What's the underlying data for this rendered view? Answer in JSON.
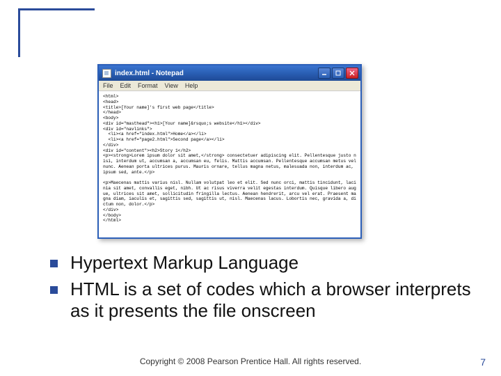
{
  "notepad": {
    "title": "index.html - Notepad",
    "menus": [
      "File",
      "Edit",
      "Format",
      "View",
      "Help"
    ],
    "content": "<html>\n<head>\n<title>[Your name]'s first web page</title>\n</head>\n<body>\n<div id=\"masthead\"><h1>[Your name]&rsquo;s website</h1></div>\n<div id=\"navlinks\">\n  <li><a href=\"index.html\">Home</a></li>\n  <li><a href=\"page2.html\">Second page</a></li>\n</div>\n<div id=\"content\"><h2>Story 1</h2>\n<p><strong>Lorem ipsum dolor sit amet,</strong> consectetuer adipiscing elit. Pellentesque justo nisi, interdum ut, accumsan a, accumsan eu, felis. Mattis accumsan. Pellentesque accumsan metus vel nunc. Aenean porta ultrices purus. Mauris ornare, tellus magna netus, malesuada non, interdum ac, ipsum sed, ante.</p>\n\n<p>Maecenas mattis varius nisl. Nullam volutpat leo et elit. Sed nunc orci, mattis tincidunt, lacinia sit amet, convallis eget, nibh. Ut ac risus viverra velit egestas interdum. Quisque libero augue, ultrices sit amet, sollicitudin fringilla lectus. Aenean hendrerit, arcu vel erat. Praesent magna diam, iaculis et, sagittis sed, sagittis ut, nisl. Maecenas lacus. Lobortis nec, gravida a, dictum non, dolor.</p>\n</div>\n</body>\n</html>"
  },
  "bullets": [
    "Hypertext Markup Language",
    "HTML is a set of codes which a browser interprets as it presents the file onscreen"
  ],
  "footer": "Copyright © 2008 Pearson Prentice Hall. All rights reserved.",
  "page_number": "7"
}
